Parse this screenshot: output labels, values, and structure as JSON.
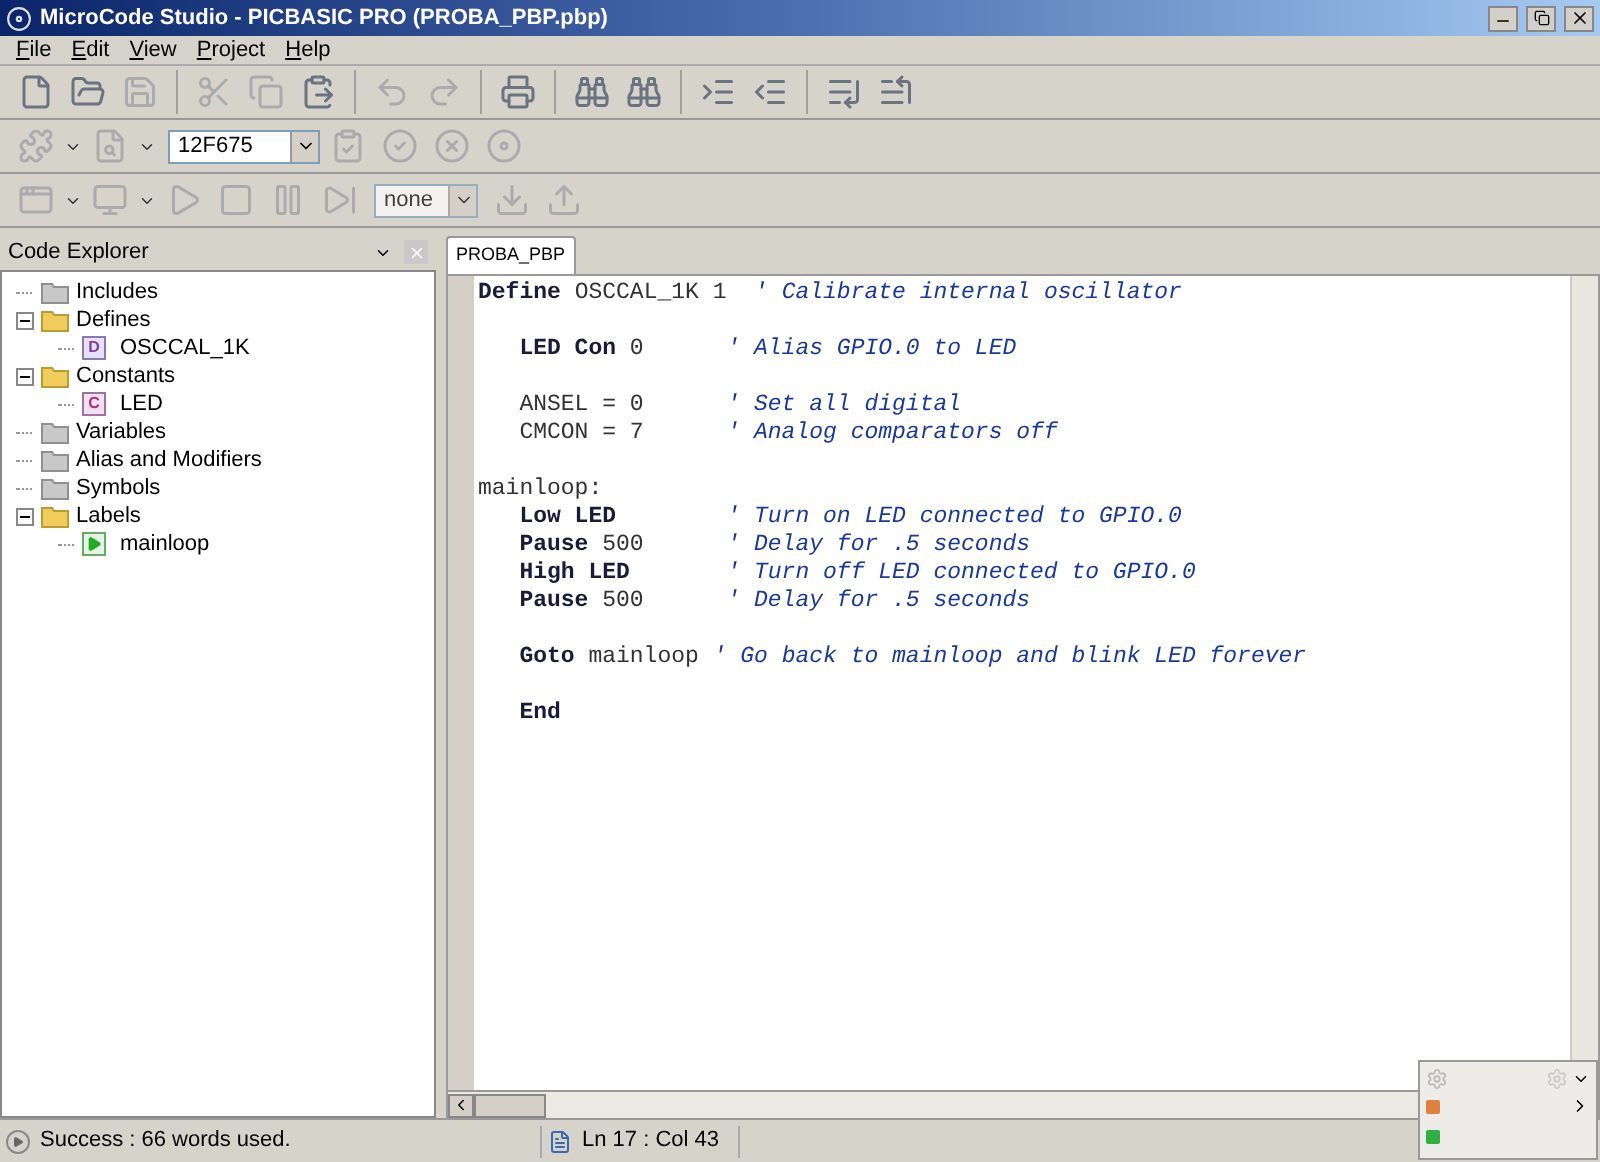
{
  "window": {
    "title": "MicroCode Studio - PICBASIC PRO (PROBA_PBP.pbp)"
  },
  "menu": [
    "File",
    "Edit",
    "View",
    "Project",
    "Help"
  ],
  "toolbar_device": {
    "value": "12F675"
  },
  "toolbar_port": {
    "value": "none"
  },
  "code_explorer": {
    "title": "Code Explorer",
    "items": [
      {
        "label": "Includes"
      },
      {
        "label": "Defines",
        "expanded": true,
        "children": [
          {
            "label": "OSCCAL_1K",
            "kind": "define",
            "badge": "D"
          }
        ]
      },
      {
        "label": "Constants",
        "expanded": true,
        "children": [
          {
            "label": "LED",
            "kind": "constant",
            "badge": "C"
          }
        ]
      },
      {
        "label": "Variables"
      },
      {
        "label": "Alias and Modifiers"
      },
      {
        "label": "Symbols"
      },
      {
        "label": "Labels",
        "expanded": true,
        "children": [
          {
            "label": "mainloop",
            "kind": "label"
          }
        ]
      }
    ]
  },
  "editor": {
    "tab": "PROBA_PBP",
    "lines": [
      {
        "kind": "code",
        "indent": false,
        "aligned": false,
        "keyword": "Define",
        "rest": "OSCCAL_1K 1",
        "comment": "' Calibrate internal oscillator"
      },
      {
        "kind": "blank"
      },
      {
        "kind": "code",
        "indent": true,
        "aligned": true,
        "keyword": "LED Con",
        "rest": "0",
        "comment": "' Alias GPIO.0 to LED"
      },
      {
        "kind": "blank"
      },
      {
        "kind": "code",
        "indent": true,
        "aligned": true,
        "rest": "ANSEL = 0",
        "comment": "' Set all digital"
      },
      {
        "kind": "code",
        "indent": true,
        "aligned": true,
        "rest": "CMCON = 7",
        "comment": "' Analog comparators off"
      },
      {
        "kind": "blank"
      },
      {
        "kind": "code",
        "indent": false,
        "rest": "mainloop:"
      },
      {
        "kind": "code",
        "indent": true,
        "aligned": true,
        "keyword": "Low LED",
        "comment": "' Turn on LED connected to GPIO.0"
      },
      {
        "kind": "code",
        "indent": true,
        "aligned": true,
        "keyword": "Pause",
        "rest": "500",
        "comment": "' Delay for .5 seconds"
      },
      {
        "kind": "code",
        "indent": true,
        "aligned": true,
        "keyword": "High LED",
        "comment": "' Turn off LED connected to GPIO.0"
      },
      {
        "kind": "code",
        "indent": true,
        "aligned": true,
        "keyword": "Pause",
        "rest": "500",
        "comment": "' Delay for .5 seconds"
      },
      {
        "kind": "blank"
      },
      {
        "kind": "code",
        "indent": true,
        "aligned": false,
        "keyword": "Goto",
        "rest": "mainloop",
        "comment": "' Go back to mainloop and blink LED forever"
      },
      {
        "kind": "blank"
      },
      {
        "kind": "code",
        "indent": true,
        "keyword": "End"
      }
    ]
  },
  "status_bar": {
    "message": "Success : 66 words used.",
    "position": "Ln 17 : Col 43"
  }
}
